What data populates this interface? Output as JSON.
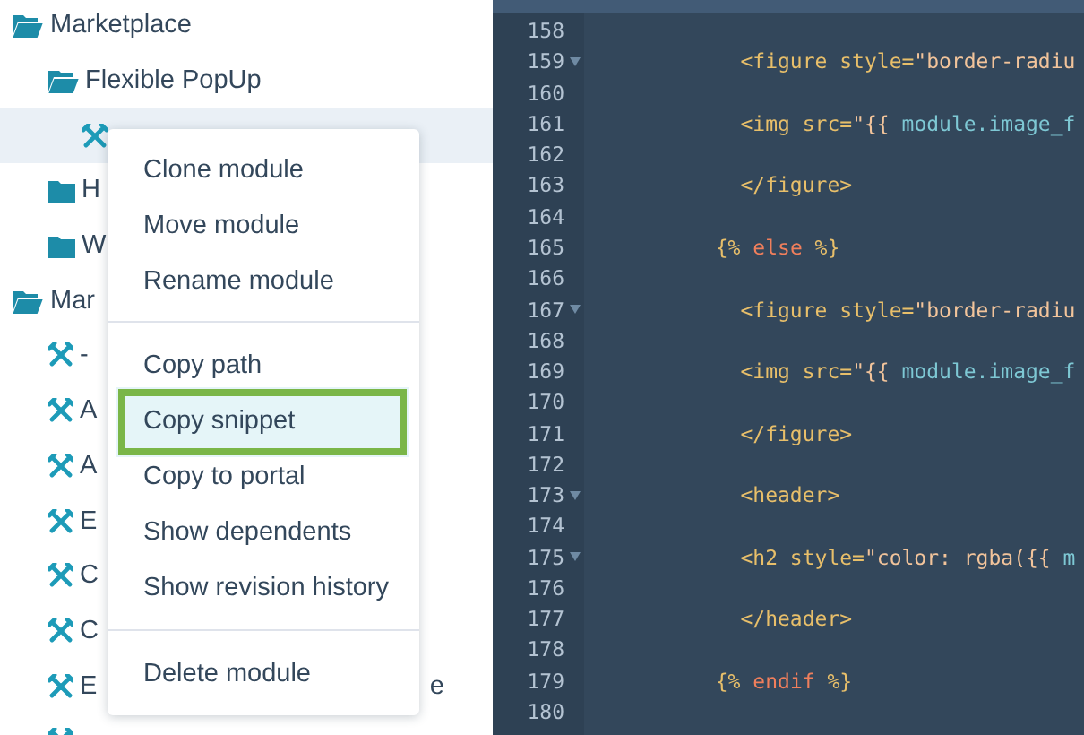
{
  "tree": [
    {
      "kind": "folder",
      "label": "Marketplace",
      "expanded": true,
      "selected": false,
      "children": [
        {
          "kind": "folder",
          "label": "Flexible PopUp",
          "expanded": true,
          "selected": false,
          "children": [
            {
              "kind": "module",
              "selected": true
            }
          ]
        },
        {
          "kind": "folder",
          "label": "H",
          "expanded": false,
          "selected": false
        },
        {
          "kind": "folder",
          "label": "W",
          "expanded": false,
          "selected": false
        }
      ]
    },
    {
      "kind": "folder",
      "label": "Mar",
      "expanded": true,
      "selected": false,
      "children": [
        {
          "kind": "module",
          "label": "-",
          "selected": false
        },
        {
          "kind": "module",
          "label": "A",
          "selected": false
        },
        {
          "kind": "module",
          "label": "A",
          "selected": false
        },
        {
          "kind": "module",
          "label": "E",
          "selected": false
        },
        {
          "kind": "module",
          "label": "C",
          "selected": false
        },
        {
          "kind": "module",
          "label": "C",
          "selected": false
        },
        {
          "kind": "module",
          "label": "E",
          "tail": "e",
          "selected": false
        },
        {
          "kind": "module",
          "selected": false
        }
      ]
    }
  ],
  "context_menu": {
    "groups": [
      [
        {
          "label": "Clone module",
          "selected": false
        },
        {
          "label": "Move module",
          "selected": false
        },
        {
          "label": "Rename module",
          "selected": false
        }
      ],
      [
        {
          "label": "Copy path",
          "selected": false
        },
        {
          "label": "Copy snippet",
          "selected": true
        },
        {
          "label": "Copy to portal",
          "selected": false
        },
        {
          "label": "Show dependents",
          "selected": false
        },
        {
          "label": "Show revision history",
          "selected": false
        }
      ],
      [
        {
          "label": "Delete module",
          "selected": false
        }
      ]
    ]
  },
  "editor": {
    "lines": [
      {
        "number": "158",
        "fold": false
      },
      {
        "number": "159",
        "fold": true,
        "tokens": [
          {
            "kind": "tag",
            "text": "          <figure style="
          },
          {
            "kind": "string",
            "text": "\"border-radiu"
          }
        ]
      },
      {
        "number": "160",
        "fold": false
      },
      {
        "number": "161",
        "fold": false,
        "tokens": [
          {
            "kind": "tag",
            "text": "          <img src="
          },
          {
            "kind": "string",
            "text": "\"{{"
          },
          {
            "kind": "var",
            "text": " module.image_f"
          }
        ]
      },
      {
        "number": "162",
        "fold": false
      },
      {
        "number": "163",
        "fold": false,
        "tokens": [
          {
            "kind": "tag",
            "text": "          </figure>"
          }
        ]
      },
      {
        "number": "164",
        "fold": false
      },
      {
        "number": "165",
        "fold": false,
        "tokens": [
          {
            "kind": "delim",
            "text": "        {%"
          },
          {
            "kind": "keyword",
            "text": " else "
          },
          {
            "kind": "delim",
            "text": "%}"
          }
        ]
      },
      {
        "number": "166",
        "fold": false
      },
      {
        "number": "167",
        "fold": true,
        "tokens": [
          {
            "kind": "tag",
            "text": "          <figure style="
          },
          {
            "kind": "string",
            "text": "\"border-radiu"
          }
        ]
      },
      {
        "number": "168",
        "fold": false
      },
      {
        "number": "169",
        "fold": false,
        "tokens": [
          {
            "kind": "tag",
            "text": "          <img src="
          },
          {
            "kind": "string",
            "text": "\"{{"
          },
          {
            "kind": "var",
            "text": " module.image_f"
          }
        ]
      },
      {
        "number": "170",
        "fold": false
      },
      {
        "number": "171",
        "fold": false,
        "tokens": [
          {
            "kind": "tag",
            "text": "          </figure>"
          }
        ]
      },
      {
        "number": "172",
        "fold": false
      },
      {
        "number": "173",
        "fold": true,
        "tokens": [
          {
            "kind": "tag",
            "text": "          <header>"
          }
        ]
      },
      {
        "number": "174",
        "fold": false
      },
      {
        "number": "175",
        "fold": true,
        "tokens": [
          {
            "kind": "tag",
            "text": "          <h2 style="
          },
          {
            "kind": "string",
            "text": "\"color: rgba({{"
          },
          {
            "kind": "var",
            "text": " m"
          }
        ]
      },
      {
        "number": "176",
        "fold": false
      },
      {
        "number": "177",
        "fold": false,
        "tokens": [
          {
            "kind": "tag",
            "text": "          </header>"
          }
        ]
      },
      {
        "number": "178",
        "fold": false
      },
      {
        "number": "179",
        "fold": false,
        "tokens": [
          {
            "kind": "delim",
            "text": "        {%"
          },
          {
            "kind": "keyword",
            "text": " endif "
          },
          {
            "kind": "delim",
            "text": "%}"
          }
        ]
      },
      {
        "number": "180",
        "fold": false
      }
    ]
  }
}
